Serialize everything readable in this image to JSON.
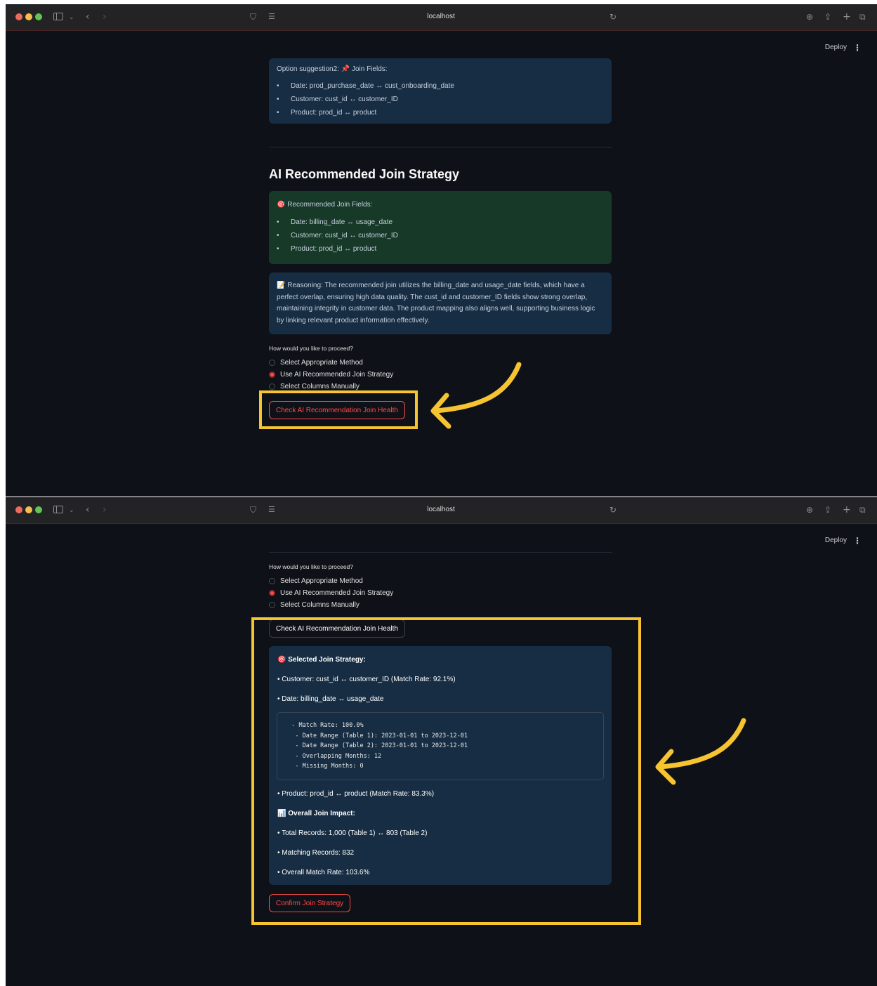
{
  "browser": {
    "url": "localhost",
    "deploy_label": "Deploy",
    "menu_glyph": "⋮",
    "icons": [
      "sidebar-icon",
      "chevron-down-icon",
      "back-icon",
      "forward-icon",
      "shield-icon",
      "reader-icon",
      "reload-icon",
      "download-icon",
      "share-icon",
      "new-tab-icon",
      "tabs-icon"
    ]
  },
  "screen1": {
    "option2": {
      "title": "Option suggestion2: 📌 Join Fields:",
      "items": [
        "Date: prod_purchase_date ↔ cust_onboarding_date",
        "Customer: cust_id ↔ customer_ID",
        "Product: prod_id ↔ product"
      ]
    },
    "heading": "AI Recommended Join Strategy",
    "recommended": {
      "title": "🎯 Recommended Join Fields:",
      "items": [
        "Date: billing_date ↔ usage_date",
        "Customer: cust_id ↔ customer_ID",
        "Product: prod_id ↔ product"
      ]
    },
    "reasoning": "📝 Reasoning: The recommended join utilizes the billing_date and usage_date fields, which have a perfect overlap, ensuring high data quality. The cust_id and customer_ID fields show strong overlap, maintaining integrity in customer data. The product mapping also aligns well, supporting business logic by linking relevant product information effectively.",
    "radio_label": "How would you like to proceed?",
    "options": [
      "Select Appropriate Method",
      "Use AI Recommended Join Strategy",
      "Select Columns Manually"
    ],
    "selected_index": 1,
    "check_button": "Check AI Recommendation Join Health"
  },
  "screen2": {
    "radio_label": "How would you like to proceed?",
    "options": [
      "Select Appropriate Method",
      "Use AI Recommended Join Strategy",
      "Select Columns Manually"
    ],
    "selected_index": 1,
    "check_button": "Check AI Recommendation Join Health",
    "selected_title": "🎯 Selected Join Strategy:",
    "customer_line": "• Customer: cust_id ↔ customer_ID (Match Rate: 92.1%)",
    "date_line": "• Date: billing_date ↔ usage_date",
    "code": "  - Match Rate: 100.0%\n   - Date Range (Table 1): 2023-01-01 to 2023-12-01\n   - Date Range (Table 2): 2023-01-01 to 2023-12-01\n   - Overlapping Months: 12\n   - Missing Months: 0",
    "product_line": "• Product: prod_id ↔ product (Match Rate: 83.3%)",
    "impact_title": "📊 Overall Join Impact:",
    "total_records": "• Total Records: 1,000 (Table 1) ↔ 803 (Table 2)",
    "matching_records": "• Matching Records: 832",
    "overall_rate": "• Overall Match Rate: 103.6%",
    "confirm_button": "Confirm Join Strategy"
  },
  "colors": {
    "highlight": "#f7c431",
    "accent_red": "#ff4b4b",
    "info_bg": "#172d43",
    "success_bg": "#173928",
    "app_bg": "#0e1117"
  }
}
